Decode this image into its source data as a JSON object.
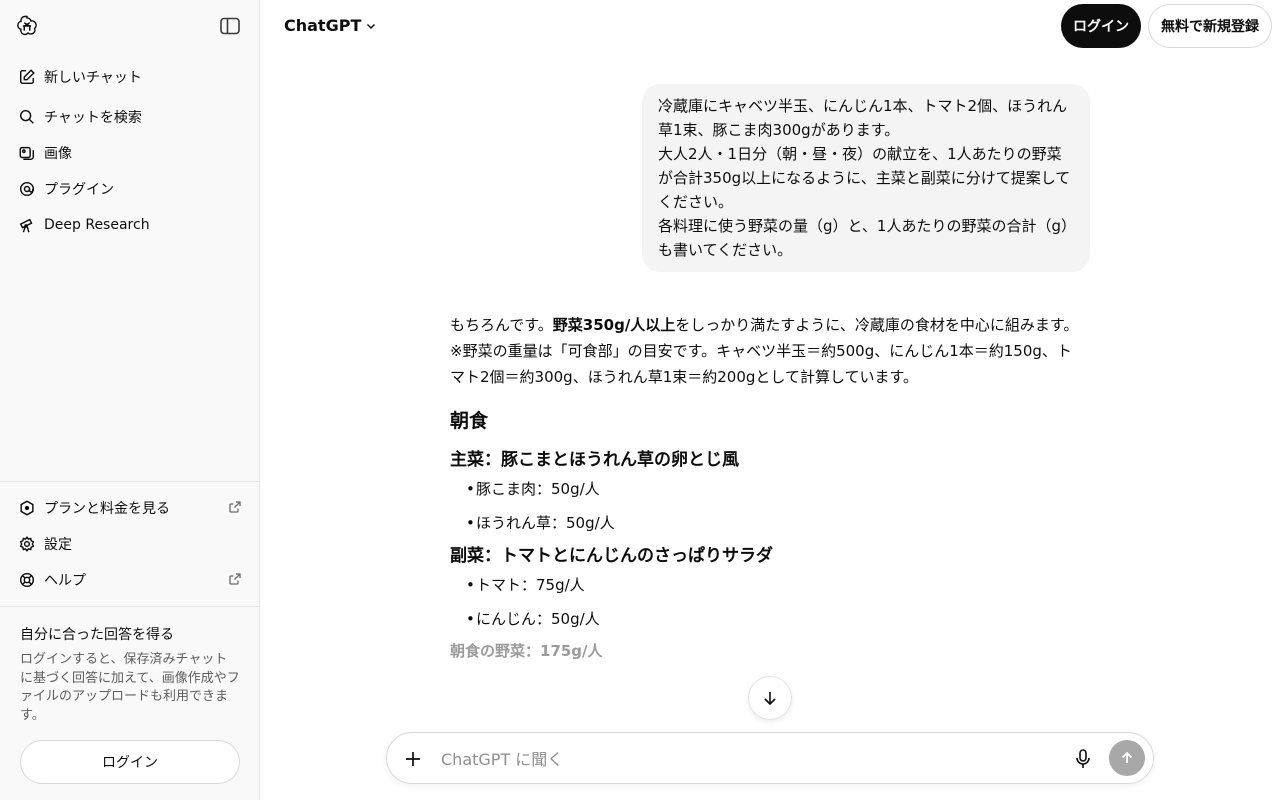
{
  "sidebar": {
    "nav": [
      {
        "label": "新しいチャット",
        "icon": "edit-icon"
      },
      {
        "label": "チャットを検索",
        "icon": "search-icon"
      },
      {
        "label": "画像",
        "icon": "image-icon"
      },
      {
        "label": "プラグイン",
        "icon": "plugin-icon"
      },
      {
        "label": "Deep Research",
        "icon": "telescope-icon"
      }
    ],
    "bottom": [
      {
        "label": "プランと料金を見る",
        "icon": "plan-icon"
      },
      {
        "label": "設定",
        "icon": "gear-icon"
      },
      {
        "label": "ヘルプ",
        "icon": "help-icon"
      }
    ],
    "promo_title": "自分に合った回答を得る",
    "promo_desc": "ログインすると、保存済みチャットに基づく回答に加えて、画像作成やファイルのアップロードも利用できます。",
    "login_label": "ログイン"
  },
  "header": {
    "model": "ChatGPT",
    "login_label": "ログイン",
    "signup_label": "無料で新規登録"
  },
  "user_message": {
    "lines": [
      "冷蔵庫にキャベツ半玉、にんじん1本、トマト2個、ほうれん草1束、豚こま肉300gがあります。",
      "大人2人・1日分（朝・昼・夜）の献立を、1人あたりの野菜が合計350g以上になるように、主菜と副菜に分けて提案してください。",
      "各料理に使う野菜の量（g）と、1人あたりの野菜の合計（g）も書いてください。"
    ]
  },
  "answer": {
    "intro_a": "もちろんです。",
    "intro_bold": "野菜350g/人以上",
    "intro_b": "をしっかり満たすように、冷蔵庫の食材を中心に組みます。",
    "note": "※野菜の重量は「可食部」の目安です。キャベツ半玉＝約500g、にんじん1本＝約150g、トマト2個＝約300g、ほうれん草1束＝約200gとして計算しています。",
    "breakfast_heading": "朝食",
    "main_title": "主菜：豚こまとほうれん草の卵とじ風",
    "main_items": [
      "豚こま肉：50g/人",
      "ほうれん草：50g/人"
    ],
    "side_title": "副菜：トマトとにんじんのさっぱりサラダ",
    "side_items": [
      "トマト：75g/人",
      "にんじん：50g/人"
    ],
    "breakfast_total": "朝食の野菜：175g/人"
  },
  "composer": {
    "placeholder": "ChatGPT に聞く"
  },
  "colors": {
    "primary_button": "#0d0d0d",
    "sidebar_bg": "#f9f9f9",
    "bubble_bg": "#f4f4f4",
    "send_disabled": "#a8a8a8"
  }
}
